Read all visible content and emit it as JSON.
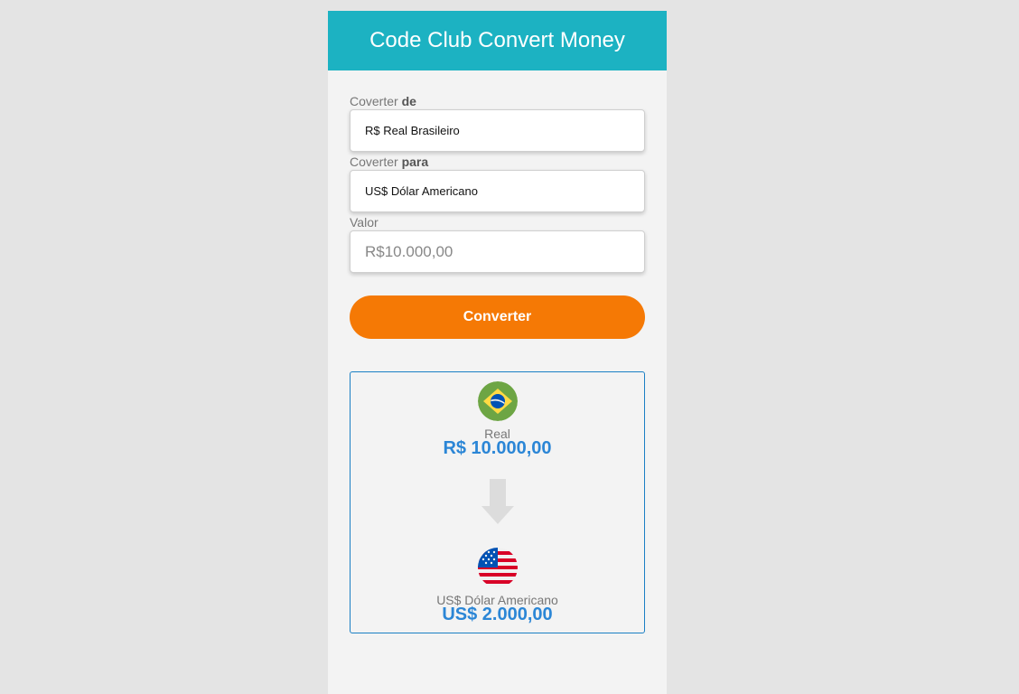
{
  "header": {
    "title": "Code Club Convert Money"
  },
  "form": {
    "from": {
      "label_prefix": "Coverter",
      "label_strong": "de",
      "selected": "R$ Real Brasileiro"
    },
    "to": {
      "label_prefix": "Coverter",
      "label_strong": "para",
      "selected": "US$ Dólar Americano"
    },
    "value": {
      "label": "Valor",
      "placeholder": "R$10.000,00"
    },
    "submit_label": "Converter"
  },
  "result": {
    "source": {
      "flag_icon": "brazil-flag-icon",
      "name": "Real",
      "amount": "R$ 10.000,00"
    },
    "arrow_icon": "arrow-down-icon",
    "target": {
      "flag_icon": "usa-flag-icon",
      "name": "US$ Dólar Americano",
      "amount": "US$ 2.000,00"
    }
  },
  "colors": {
    "header": "#1cb2c2",
    "button": "#f57905",
    "amount": "#2b86d6",
    "result_border": "#1a7fc4"
  }
}
